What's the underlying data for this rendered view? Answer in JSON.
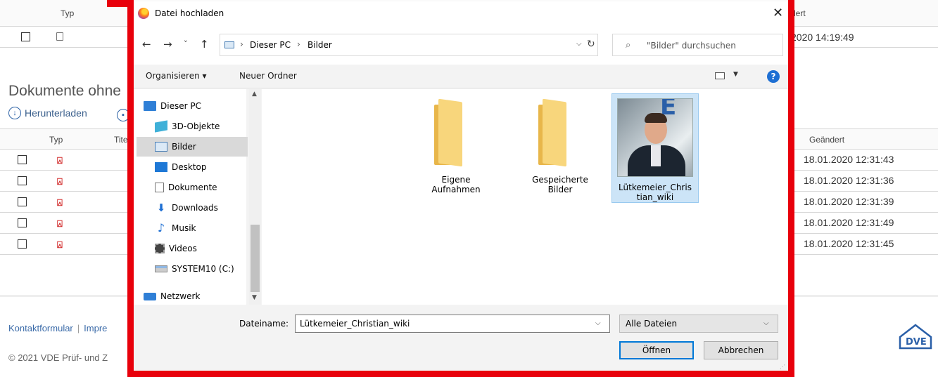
{
  "background": {
    "table1": {
      "col_typ": "Typ",
      "col_geaendert": "dert",
      "row_date": "2020 14:19:49"
    },
    "section_title": "Dokumente ohne",
    "download_label": "Herunterladen",
    "table2": {
      "col_typ": "Typ",
      "col_titel": "Tite",
      "col_geaendert": "Geändert",
      "rows": [
        {
          "date": "18.01.2020 12:31:43"
        },
        {
          "date": "18.01.2020 12:31:36"
        },
        {
          "date": "18.01.2020 12:31:39"
        },
        {
          "date": "18.01.2020 12:31:49"
        },
        {
          "date": "18.01.2020 12:31:45"
        }
      ]
    },
    "footer": {
      "link1": "Kontaktformular",
      "sep": "|",
      "link2": "Impre",
      "copyright": "© 2021 VDE Prüf- und Z"
    },
    "logo_text": "D^VE"
  },
  "dialog": {
    "title": "Datei hochladen",
    "nav": {
      "back": "←",
      "forward": "→",
      "recent": "˅",
      "up": "↑",
      "address": [
        "Dieser PC",
        "Bilder"
      ],
      "address_sep": "›",
      "refresh": "↻",
      "search_placeholder": "\"Bilder\" durchsuchen"
    },
    "commands": {
      "organize": "Organisieren ▾",
      "new_folder": "Neuer Ordner",
      "help": "?"
    },
    "tree": [
      {
        "label": "Dieser PC",
        "icon": "pc-icon"
      },
      {
        "label": "3D-Objekte",
        "icon": "cube-icon"
      },
      {
        "label": "Bilder",
        "icon": "pictures-icon",
        "selected": true
      },
      {
        "label": "Desktop",
        "icon": "desktop-icon"
      },
      {
        "label": "Dokumente",
        "icon": "documents-icon"
      },
      {
        "label": "Downloads",
        "icon": "download-arrow-icon"
      },
      {
        "label": "Musik",
        "icon": "music-note-icon"
      },
      {
        "label": "Videos",
        "icon": "film-icon"
      },
      {
        "label": "SYSTEM10 (C:)",
        "icon": "drive-icon"
      },
      {
        "label": "Netzwerk",
        "icon": "network-icon"
      }
    ],
    "files": [
      {
        "name_line1": "Eigene",
        "name_line2": "Aufnahmen",
        "type": "folder"
      },
      {
        "name_line1": "Gespeicherte",
        "name_line2": "Bilder",
        "type": "folder"
      },
      {
        "name_line1": "Lütkemeier_Chris",
        "name_line2": "tian_wiki",
        "type": "image",
        "selected": true
      }
    ],
    "bottom": {
      "filename_label": "Dateiname:",
      "filename_value": "Lütkemeier_Christian_wiki",
      "filetype_value": "Alle Dateien",
      "open_label": "Öffnen",
      "cancel_label": "Abbrechen"
    }
  },
  "colors": {
    "highlight_frame": "#e8000b",
    "selection": "#cce4f7",
    "link": "#3a6aa8"
  }
}
